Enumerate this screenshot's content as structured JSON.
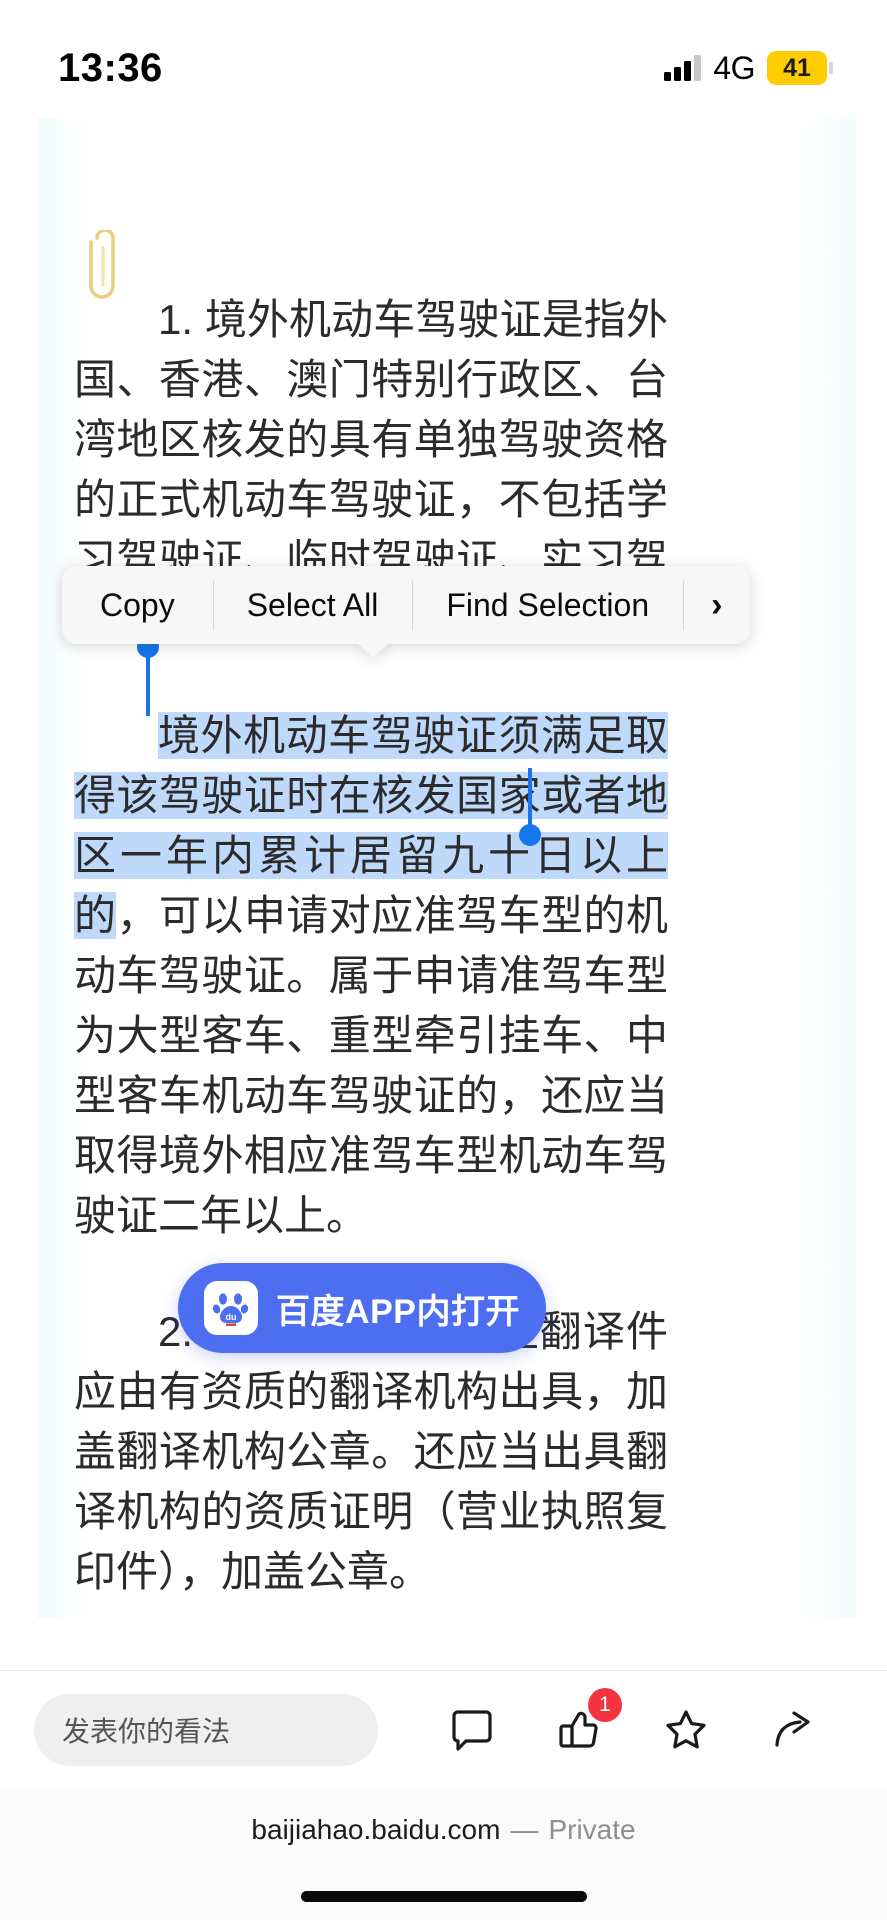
{
  "status_bar": {
    "time": "13:36",
    "network": "4G",
    "battery_level": "41",
    "battery_color": "#ffcc00"
  },
  "article": {
    "paragraph_1_prefix": "1.",
    "paragraph_1": "1. 境外机动车驾驶证是指外国、香港、澳门特别行政区、台湾地区核发的具有单独驾驶资格的正式机动车驾驶证，不包括学习驾驶证、临时驾驶证、实习驾驶证。",
    "paragraph_2_pre_selection": "",
    "paragraph_2_selected": "境外机动车驾驶证须满足取得该驾驶证时在核发国家或者地区一年内累计居留九十日以上的",
    "paragraph_2_post_selection": "，可以申请对应准驾车型的机动车驾驶证。属于申请准驾车型为大型客车、重型牵引挂车、中型客车机动车驾驶证的，还应当取得境外相应准驾车型机动车驾驶证二年以上。",
    "paragraph_3": "2.境外机动车驾驶证翻译件应由有资质的翻译机构出具，加盖翻译机构公章。还应当出具翻译机构的资质证明（营业执照复印件），加盖公章。",
    "attachment_icon": "paperclip-icon"
  },
  "selection_menu": {
    "items": [
      {
        "label": "Copy",
        "name": "copy"
      },
      {
        "label": "Select All",
        "name": "select-all"
      },
      {
        "label": "Find Selection",
        "name": "find-selection"
      },
      {
        "label": "›",
        "name": "more"
      }
    ],
    "background": "#f7f7f7",
    "handle_color": "#1478ec",
    "highlight_color": "#bfd9fb"
  },
  "baidu_button": {
    "label": "百度APP内打开",
    "icon": "baidu-paw-icon",
    "background": "#4e6ef2",
    "text_color": "#ffffff"
  },
  "comment_bar": {
    "input_placeholder": "发表你的看法",
    "actions": [
      {
        "name": "comment-icon",
        "label": ""
      },
      {
        "name": "thumbs-up-icon",
        "label": "",
        "badge": "1"
      },
      {
        "name": "favorite-star-icon",
        "label": ""
      },
      {
        "name": "share-icon",
        "label": ""
      }
    ],
    "badge_count": "1",
    "badge_color": "#f5333f"
  },
  "safari_bar": {
    "domain": "baijiahao.baidu.com",
    "separator": "—",
    "mode": "Private"
  }
}
